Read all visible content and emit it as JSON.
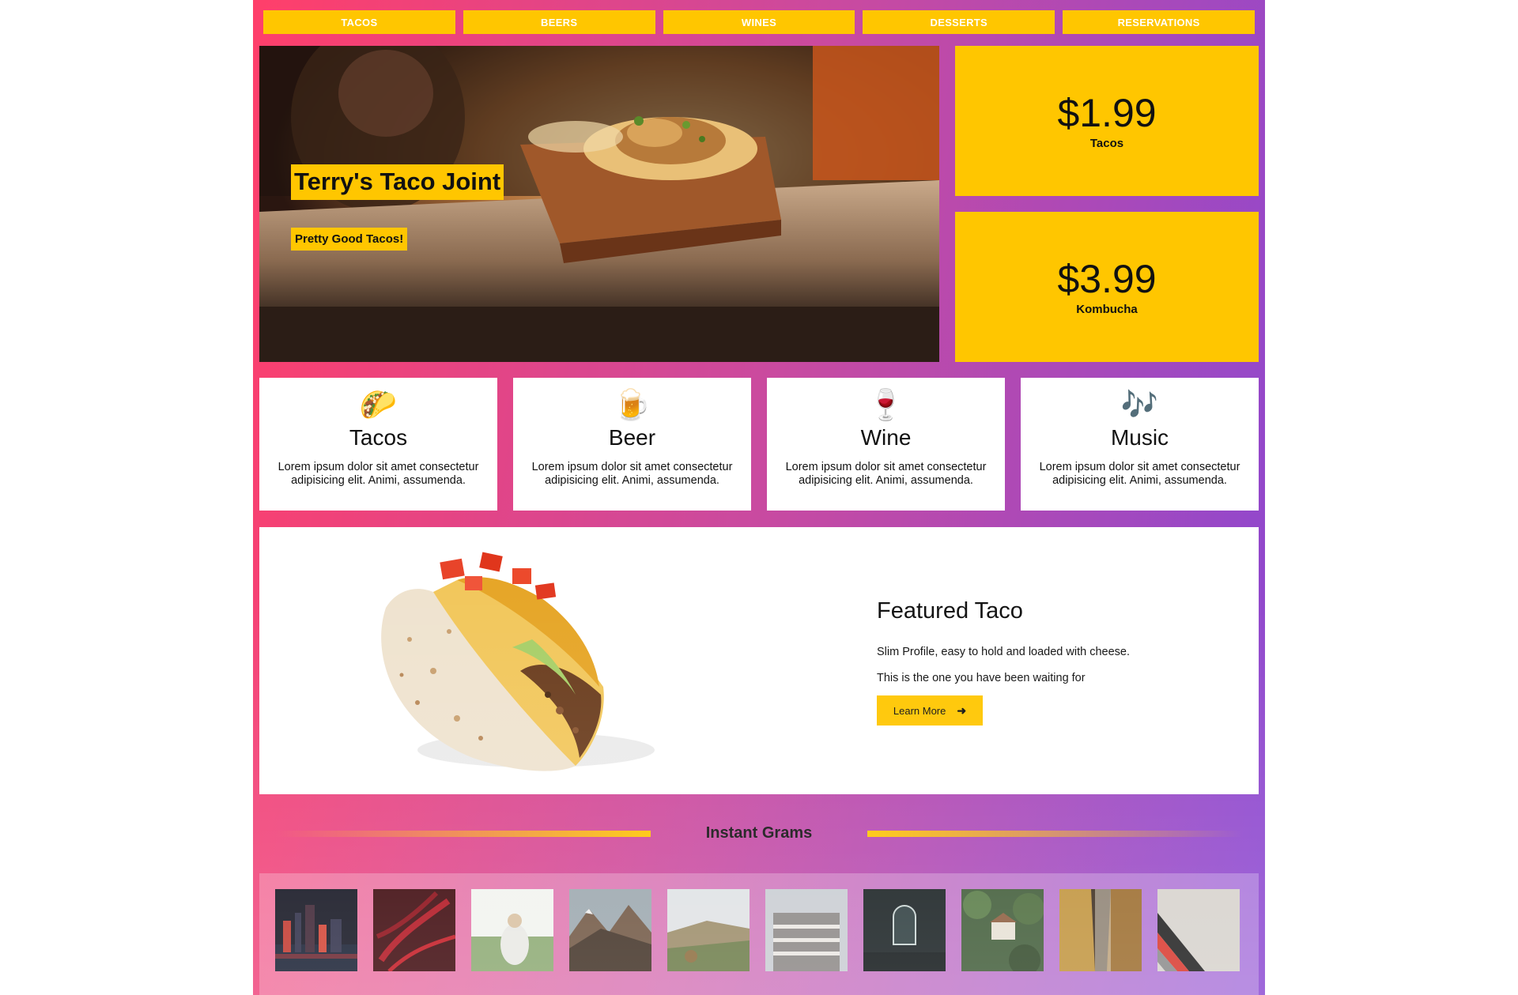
{
  "nav": {
    "items": [
      "TACOS",
      "BEERS",
      "WINES",
      "DESSERTS",
      "RESERVATIONS"
    ]
  },
  "hero": {
    "title": "Terry's Taco Joint",
    "subtitle": "Pretty Good Tacos!"
  },
  "prices": [
    {
      "amount": "$1.99",
      "label": "Tacos"
    },
    {
      "amount": "$3.99",
      "label": "Kombucha"
    }
  ],
  "features": [
    {
      "icon": "taco-icon",
      "glyph": "🌮",
      "title": "Tacos",
      "text": "Lorem ipsum dolor sit amet consectetur adipisicing elit. Animi, assumenda."
    },
    {
      "icon": "beer-icon",
      "glyph": "🍺",
      "title": "Beer",
      "text": "Lorem ipsum dolor sit amet consectetur adipisicing elit. Animi, assumenda."
    },
    {
      "icon": "wine-icon",
      "glyph": "🍷",
      "title": "Wine",
      "text": "Lorem ipsum dolor sit amet consectetur adipisicing elit. Animi, assumenda."
    },
    {
      "icon": "music-icon",
      "glyph": "🎶",
      "title": "Music",
      "text": "Lorem ipsum dolor sit amet consectetur adipisicing elit. Animi, assumenda."
    }
  ],
  "featured": {
    "title": "Featured Taco",
    "line1": "Slim Profile, easy to hold and loaded with cheese.",
    "line2": "This is the one you have been waiting for",
    "button_label": "Learn More",
    "button_icon": "arrow-right-icon"
  },
  "instant_grams": {
    "title": "Instant Grams",
    "photos": [
      "city-night-photo",
      "red-fern-photo",
      "woman-in-grass-photo",
      "mountains-photo",
      "hillside-photo",
      "building-photo",
      "dark-archway-photo",
      "castle-forest-photo",
      "narrow-street-photo",
      "abstract-stripes-photo"
    ]
  },
  "colors": {
    "accent": "#ffc600",
    "gradient_start": "#ff3f6a",
    "gradient_end": "#8a48d2"
  }
}
